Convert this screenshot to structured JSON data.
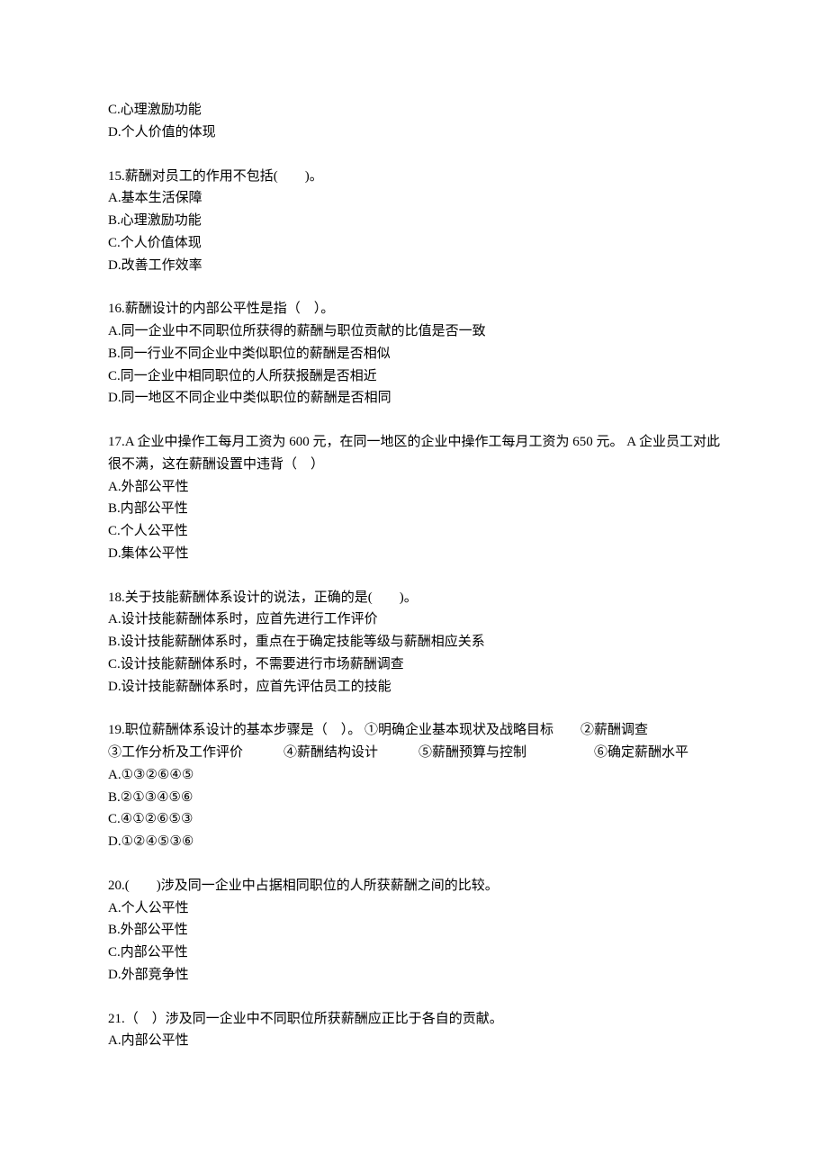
{
  "q14_trail": {
    "optC": "C.心理激励功能",
    "optD": "D.个人价值的体现"
  },
  "q15": {
    "stem": "15.薪酬对员工的作用不包括(　　)。",
    "optA": "A.基本生活保障",
    "optB": "B.心理激励功能",
    "optC": "C.个人价值体现",
    "optD": "D.改善工作效率"
  },
  "q16": {
    "stem": "16.薪酬设计的内部公平性是指（　）。",
    "optA": "A.同一企业中不同职位所获得的薪酬与职位贡献的比值是否一致",
    "optB": "B.同一行业不同企业中类似职位的薪酬是否相似",
    "optC": "C.同一企业中相同职位的人所获报酬是否相近",
    "optD": "D.同一地区不同企业中类似职位的薪酬是否相同"
  },
  "q17": {
    "stem": "17.A 企业中操作工每月工资为 600 元，在同一地区的企业中操作工每月工资为 650 元。 A 企业员工对此很不满，这在薪酬设置中违背（　）",
    "optA": "A.外部公平性",
    "optB": "B.内部公平性",
    "optC": "C.个人公平性",
    "optD": "D.集体公平性"
  },
  "q18": {
    "stem": "18.关于技能薪酬体系设计的说法，正确的是(　　)。",
    "optA": "A.设计技能薪酬体系时，应首先进行工作评价",
    "optB": "B.设计技能薪酬体系时，重点在于确定技能等级与薪酬相应关系",
    "optC": "C.设计技能薪酬体系时，不需要进行市场薪酬调查",
    "optD": "D.设计技能薪酬体系时，应首先评估员工的技能"
  },
  "q19": {
    "stem_line1": "19.职位薪酬体系设计的基本步骤是（　）。  ①明确企业基本现状及战略目标　　②薪酬调查",
    "stem_line2": "③工作分析及工作评价　　　④薪酬结构设计　　　⑤薪酬预算与控制　　　　　⑥确定薪酬水平",
    "optA": "A.①③②⑥④⑤",
    "optB": "B.②①③④⑤⑥",
    "optC": "C.④①②⑥⑤③",
    "optD": "D.①②④⑤③⑥"
  },
  "q20": {
    "stem": "20.(　　)涉及同一企业中占据相同职位的人所获薪酬之间的比较。",
    "optA": "A.个人公平性",
    "optB": "B.外部公平性",
    "optC": "C.内部公平性",
    "optD": "D.外部竞争性"
  },
  "q21": {
    "stem": "21.（　）涉及同一企业中不同职位所获薪酬应正比于各自的贡献。",
    "optA": "A.内部公平性"
  }
}
